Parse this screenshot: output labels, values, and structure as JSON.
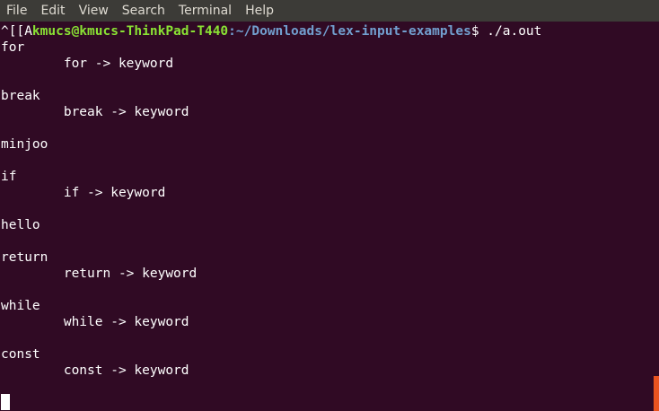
{
  "menubar": {
    "items": [
      "File",
      "Edit",
      "View",
      "Search",
      "Terminal",
      "Help"
    ]
  },
  "terminal": {
    "prompt": {
      "prefix": "^[[A",
      "user_host": "kmucs@kmucs-ThinkPad-T440",
      "separator": ":",
      "path": "~/Downloads/lex-input-examples",
      "symbol": "$ ",
      "command": "./a.out"
    },
    "output": [
      "for",
      "        for -> keyword",
      "",
      "break",
      "        break -> keyword",
      "",
      "minjoo",
      "",
      "if",
      "        if -> keyword",
      "",
      "hello",
      "",
      "return",
      "        return -> keyword",
      "",
      "while",
      "        while -> keyword",
      "",
      "const",
      "        const -> keyword"
    ]
  },
  "colors": {
    "background": "#300a24",
    "menubar": "#3c3b37",
    "user_host": "#8ae234",
    "path": "#729fcf",
    "scrollbar": "#e95420"
  }
}
